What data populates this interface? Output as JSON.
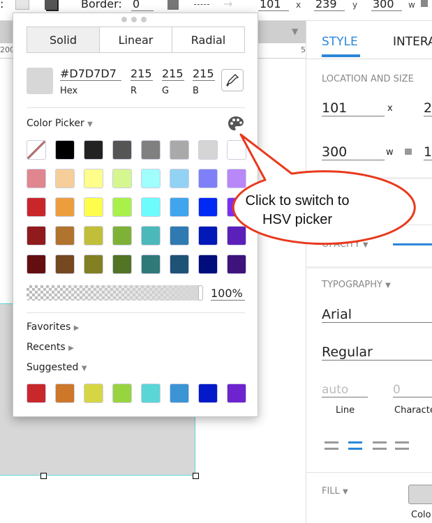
{
  "toolbar": {
    "border_label": "Border:",
    "border_value": "0",
    "x_value": "101",
    "x_unit": "x",
    "y_value": "239",
    "y_unit": "y",
    "w_value": "300",
    "w_unit": "w"
  },
  "ruler": {
    "left_label": "200",
    "right_label": "5"
  },
  "panel": {
    "tabs": [
      {
        "label": "STYLE",
        "active": true
      },
      {
        "label": "INTERA"
      }
    ],
    "location_title": "LOCATION AND SIZE",
    "x": "101",
    "x_unit": "x",
    "x2": "2",
    "w": "300",
    "w_unit": "w",
    "w2": "1",
    "opacity_title": "OPACITY",
    "typography_title": "TYPOGRAPHY",
    "font": "Arial",
    "weight": "Regular",
    "line_placeholder": "auto",
    "line_label": "Line",
    "char_placeholder": "0",
    "char_label": "Characte",
    "fill_title": "FILL",
    "color_label": "Colo",
    "accent": "#2b87d8"
  },
  "picker": {
    "tabs": [
      "Solid",
      "Linear",
      "Radial"
    ],
    "active_tab": "Solid",
    "hex": "#D7D7D7",
    "hex_label": "Hex",
    "r": "215",
    "g": "215",
    "b": "215",
    "r_label": "R",
    "g_label": "G",
    "b_label": "B",
    "section": "Color Picker",
    "opacity": "100%",
    "favorites": "Favorites",
    "recents": "Recents",
    "suggested": "Suggested",
    "swatches": [
      [
        "none",
        "#000000",
        "#222222",
        "#555555",
        "#808080",
        "#a9a9a9",
        "#d5d5d5",
        "#ffffff"
      ],
      [
        "#e0868e",
        "#f5ce9a",
        "#fffe8a",
        "#d6f78f",
        "#a0fefd",
        "#92d2f3",
        "#7f80f9",
        "#b887f8"
      ],
      [
        "#c8262b",
        "#ec9e3f",
        "#fefd4c",
        "#a9f04a",
        "#6cfcfc",
        "#3fa5ec",
        "#0029f5",
        "#7b2ff0"
      ],
      [
        "#901a1c",
        "#b0742e",
        "#c1bf3a",
        "#7eb236",
        "#4bb9b9",
        "#2e7ab1",
        "#0219b9",
        "#5b1fba"
      ],
      [
        "#650e10",
        "#744820",
        "#828022",
        "#527424",
        "#307979",
        "#1f5277",
        "#020d7c",
        "#3e137c"
      ]
    ],
    "suggested_swatches": [
      "#c8282b",
      "#cd772a",
      "#d6d644",
      "#98d43f",
      "#5bd6d6",
      "#3b94d4",
      "#0419c9",
      "#6d24ce"
    ]
  },
  "callout": {
    "line1": "Click to switch to",
    "line2": "HSV picker",
    "color": "#e8391d"
  }
}
